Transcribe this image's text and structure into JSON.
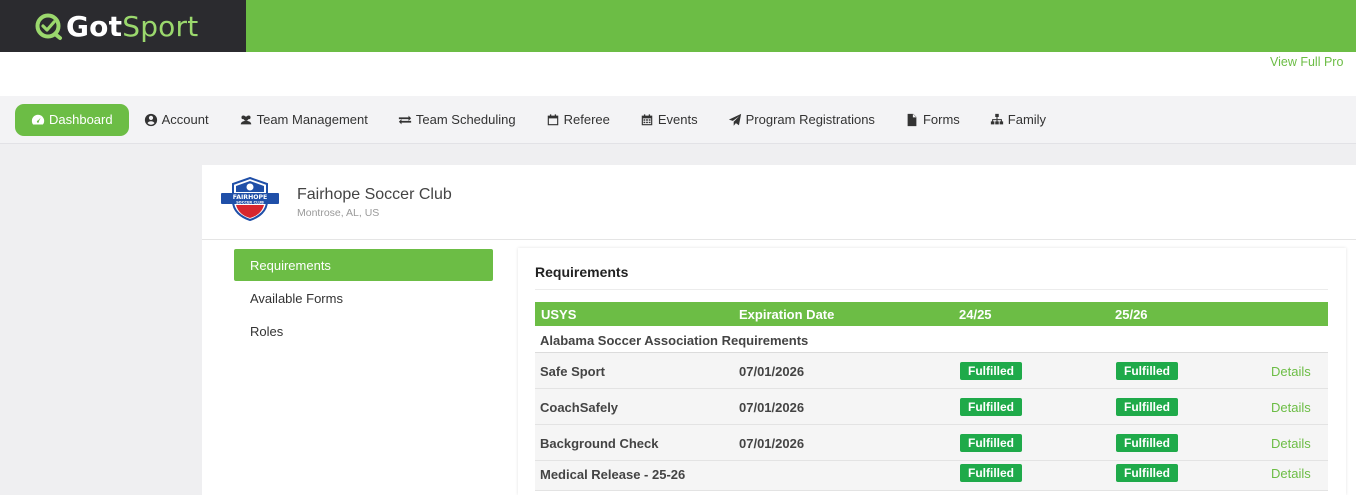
{
  "brand": {
    "got": "Got",
    "sport": "Sport"
  },
  "header": {
    "view_full": "View Full Pro"
  },
  "nav": {
    "items": [
      {
        "label": "Dashboard",
        "icon": "dashboard-icon"
      },
      {
        "label": "Account",
        "icon": "user-circle-icon"
      },
      {
        "label": "Team Management",
        "icon": "users-icon"
      },
      {
        "label": "Team Scheduling",
        "icon": "exchange-icon"
      },
      {
        "label": "Referee",
        "icon": "calendar-icon"
      },
      {
        "label": "Events",
        "icon": "calendar-grid-icon"
      },
      {
        "label": "Program Registrations",
        "icon": "paper-plane-icon"
      },
      {
        "label": "Forms",
        "icon": "file-icon"
      },
      {
        "label": "Family",
        "icon": "sitemap-icon"
      }
    ]
  },
  "club": {
    "name": "Fairhope Soccer Club",
    "location": "Montrose, AL, US",
    "logo_text_1": "FAIRHOPE",
    "logo_text_2": "SOCCER CLUB"
  },
  "side_menu": {
    "items": [
      "Requirements",
      "Available Forms",
      "Roles"
    ]
  },
  "requirements": {
    "title": "Requirements",
    "columns": [
      "USYS",
      "Expiration Date",
      "24/25",
      "25/26"
    ],
    "group": "Alabama Soccer Association Requirements",
    "rows": [
      {
        "name": "Safe Sport",
        "expiration": "07/01/2026",
        "s1": "Fulfilled",
        "s2": "Fulfilled",
        "details": "Details"
      },
      {
        "name": "CoachSafely",
        "expiration": "07/01/2026",
        "s1": "Fulfilled",
        "s2": "Fulfilled",
        "details": "Details"
      },
      {
        "name": "Background Check",
        "expiration": "07/01/2026",
        "s1": "Fulfilled",
        "s2": "Fulfilled",
        "details": "Details"
      },
      {
        "name": "Medical Release - 25-26",
        "expiration": "",
        "s1": "Fulfilled",
        "s2": "Fulfilled",
        "details": "Details"
      }
    ]
  },
  "colors": {
    "brand_green": "#6cbd45",
    "badge_green": "#1faa4a",
    "dark": "#2b2b2f"
  }
}
